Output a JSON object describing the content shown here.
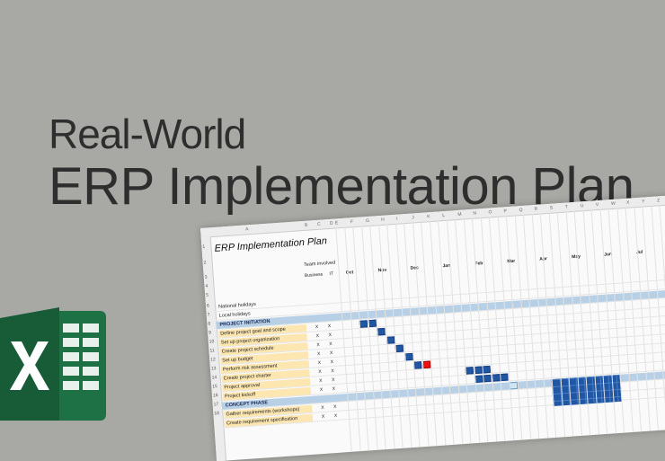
{
  "headline": {
    "subtitle": "Real-World",
    "title": "ERP Implementation Plan"
  },
  "sheet": {
    "title": "ERP Implementation Plan",
    "col_letters": [
      "A",
      "B",
      "C",
      "D",
      "E",
      "F",
      "G",
      "H",
      "I",
      "J",
      "K",
      "L",
      "M",
      "N",
      "O",
      "P",
      "Q",
      "R",
      "S",
      "T",
      "U",
      "V",
      "W",
      "X",
      "Y",
      "Z"
    ],
    "row_numbers": [
      "1",
      "2",
      "3",
      "4",
      "5",
      "6",
      "7",
      "8",
      "9",
      "10",
      "11",
      "12",
      "13",
      "14",
      "15",
      "16",
      "17",
      "18"
    ],
    "team_header": "Team involved",
    "business_label": "Business",
    "it_label": "IT",
    "months": [
      "Oct",
      "Nov",
      "Dec",
      "Jan",
      "Feb",
      "Mar",
      "Apr",
      "May",
      "Jun",
      "Jul"
    ],
    "rows": [
      {
        "label": "National holidays",
        "type": "plain"
      },
      {
        "label": "Local holidays",
        "type": "plain"
      },
      {
        "label": "PROJECT INITIATION",
        "type": "phase"
      },
      {
        "label": "Define project goal and scope",
        "type": "task",
        "biz": "X",
        "it": "X"
      },
      {
        "label": "Set up project organization",
        "type": "task",
        "biz": "X",
        "it": "X"
      },
      {
        "label": "Create project schedule",
        "type": "task",
        "biz": "X",
        "it": "X"
      },
      {
        "label": "Set up budget",
        "type": "task",
        "biz": "X",
        "it": "X"
      },
      {
        "label": "Perform risk assessment",
        "type": "task",
        "biz": "X",
        "it": "X"
      },
      {
        "label": "Create project charter",
        "type": "task",
        "biz": "X",
        "it": "X"
      },
      {
        "label": "Project approval",
        "type": "task",
        "biz": "X",
        "it": "X"
      },
      {
        "label": "Project kickoff",
        "type": "task",
        "biz": "X",
        "it": "X"
      },
      {
        "label": "CONCEPT PHASE",
        "type": "phase"
      },
      {
        "label": "Gather requirements (workshops)",
        "type": "task",
        "biz": "X",
        "it": "X"
      },
      {
        "label": "Create requirement specification",
        "type": "task",
        "biz": "X",
        "it": "X"
      }
    ]
  },
  "colors": {
    "background": "#a8a8a4",
    "gantt_bar": "#1f57a5",
    "milestone": "#e11111",
    "phase_band": "#b8d0e6",
    "excel_green": "#1e7145"
  },
  "icons": {
    "excel": "excel-logo-icon"
  }
}
